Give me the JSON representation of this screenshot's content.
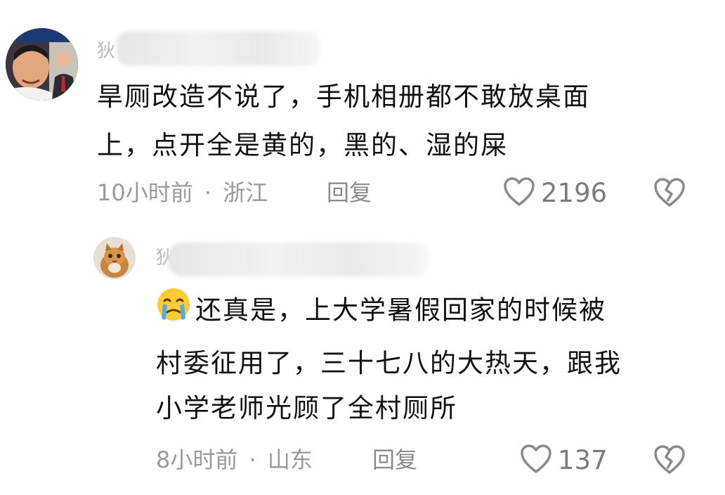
{
  "comments": [
    {
      "username_visible": "狄",
      "content_lines": [
        "旱厕改造不说了，手机相册都不敢放桌面",
        "上，点开全是黄的，黑的、湿的屎"
      ],
      "time": "10小时前",
      "separator": "·",
      "location": "浙江",
      "reply_label": "回复",
      "likes": "2196"
    },
    {
      "username_visible": "狄",
      "content_lines": [
        "还真是，上大学暑假回家的时候被",
        "村委征用了，三十七八的大热天，跟我",
        "小学老师光顾了全村厕所"
      ],
      "time": "8小时前",
      "separator": "·",
      "location": "山东",
      "reply_label": "回复",
      "likes": "137"
    }
  ],
  "icons": {
    "like": "heart-outline-icon",
    "dislike": "broken-heart-icon",
    "emoji": "crying-face-emoji"
  },
  "colors": {
    "text": "#111111",
    "meta": "#9a9a9a",
    "icon": "#8a8a8a",
    "emoji_face": "#ffcc33",
    "emoji_tears": "#5aa9e6"
  }
}
